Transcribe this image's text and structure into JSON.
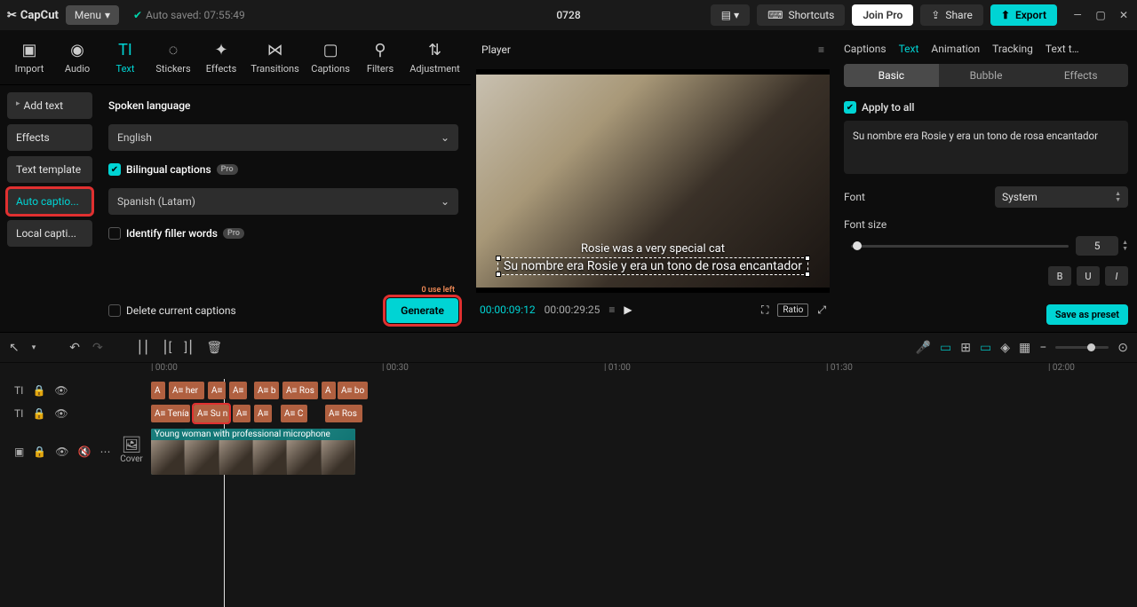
{
  "titlebar": {
    "app_name": "CapCut",
    "menu_label": "Menu",
    "autosave": "Auto saved: 07:55:49",
    "project_title": "0728",
    "shortcuts": "Shortcuts",
    "join_pro": "Join Pro",
    "share": "Share",
    "export": "Export"
  },
  "tool_tabs": [
    "Import",
    "Audio",
    "Text",
    "Stickers",
    "Effects",
    "Transitions",
    "Captions",
    "Filters",
    "Adjustment"
  ],
  "tool_tab_icons": [
    "▣",
    "◉",
    "TI",
    "◌",
    "✦",
    "⋈",
    "▢",
    "⚲",
    "⇅"
  ],
  "active_tool": 2,
  "sidebar": {
    "items": [
      "Add text",
      "Effects",
      "Text template",
      "Auto captio...",
      "Local capti..."
    ],
    "active": 3
  },
  "captions": {
    "spoken_label": "Spoken language",
    "spoken_value": "English",
    "bilingual_label": "Bilingual captions",
    "bilingual_on": true,
    "bilingual_value": "Spanish (Latam)",
    "filler_label": "Identify filler words",
    "filler_on": false,
    "delete_label": "Delete current captions",
    "delete_on": false,
    "generate": "Generate",
    "use_left": "0 use left",
    "pro": "Pro"
  },
  "player": {
    "title": "Player",
    "caption_en": "Rosie was a very special cat",
    "caption_es": "Su nombre era Rosie y era un tono de rosa encantador",
    "time_current": "00:00:09:12",
    "time_duration": "00:00:29:25",
    "ratio": "Ratio"
  },
  "right": {
    "tabs": [
      "Captions",
      "Text",
      "Animation",
      "Tracking",
      "Text t…"
    ],
    "active": 1,
    "subtabs": [
      "Basic",
      "Bubble",
      "Effects"
    ],
    "subtab_active": 0,
    "apply_all": "Apply to all",
    "text_value": "Su nombre era Rosie y era un tono de rosa encantador",
    "font_label": "Font",
    "font_value": "System",
    "size_label": "Font size",
    "size_value": "5",
    "save_preset": "Save as preset",
    "style_b": "B",
    "style_u": "U",
    "style_i": "I"
  },
  "timeline": {
    "ruler": [
      "00:00",
      "00:30",
      "01:00",
      "01:30",
      "02:00"
    ],
    "cover": "Cover",
    "video_clip_title": "Young woman with professional microphone",
    "row1": [
      {
        "l": 0,
        "w": 16,
        "t": "A"
      },
      {
        "l": 20,
        "w": 40,
        "t": "A≡ her"
      },
      {
        "l": 64,
        "w": 20,
        "t": "A≡"
      },
      {
        "l": 88,
        "w": 20,
        "t": "A≡"
      },
      {
        "l": 116,
        "w": 28,
        "t": "A≡ b"
      },
      {
        "l": 148,
        "w": 40,
        "t": "A≡ Ros"
      },
      {
        "l": 192,
        "w": 16,
        "t": "A"
      },
      {
        "l": 210,
        "w": 34,
        "t": "A≡ bo"
      }
    ],
    "row2": [
      {
        "l": 0,
        "w": 44,
        "t": "A≡ Tenía"
      },
      {
        "l": 48,
        "w": 40,
        "t": "A≡ Su n",
        "sel": true
      },
      {
        "l": 92,
        "w": 20,
        "t": "A≡"
      },
      {
        "l": 116,
        "w": 20,
        "t": "A≡"
      },
      {
        "l": 146,
        "w": 30,
        "t": "A≡ C"
      },
      {
        "l": 196,
        "w": 42,
        "t": "A≡ Ros"
      }
    ]
  }
}
